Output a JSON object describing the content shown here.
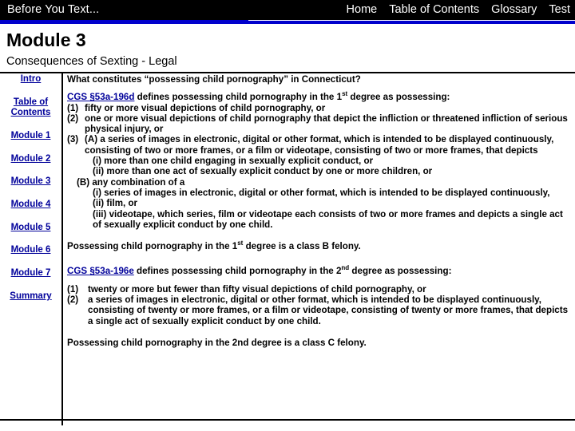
{
  "header": {
    "brand": "Before You Text...",
    "nav": [
      {
        "label": "Home",
        "name": "nav-home"
      },
      {
        "label": "Table of Contents",
        "name": "nav-table-of-contents"
      },
      {
        "label": "Glossary",
        "name": "nav-glossary"
      },
      {
        "label": "Test",
        "name": "nav-test"
      }
    ],
    "accent_color": "#0000CC",
    "bar_color": "#000000"
  },
  "page": {
    "title": "Module 3",
    "subtitle": "Consequences of Sexting - Legal"
  },
  "sidebar": {
    "link_color": "#00009A",
    "items": [
      {
        "label": "Intro"
      },
      {
        "label": "Table of Contents"
      },
      {
        "label": "Module 1"
      },
      {
        "label": "Module 2"
      },
      {
        "label": "Module 3"
      },
      {
        "label": "Module 4"
      },
      {
        "label": "Module 5"
      },
      {
        "label": "Module 6"
      },
      {
        "label": "Module 7"
      },
      {
        "label": "Summary"
      }
    ]
  },
  "content": {
    "heading": "What constitutes “possessing child pornography” in Connecticut?",
    "stat1": {
      "link": "CGS §53a-196d",
      "lead_before": " defines possessing child pornography in the 1",
      "lead_sup": "st",
      "lead_after": " degree as possessing:",
      "item1_marker": "(1)",
      "item1_text": "fifty or more visual depictions of child pornography, or",
      "item2_marker": "(2)",
      "item2_text": "one or more visual depictions of child pornography that depict the infliction or threatened infliction of serious physical injury, or",
      "item3_marker": "(3)",
      "item3_a": "(A) a series of images in electronic, digital or other format, which is intended to be displayed continuously, consisting of two or more frames, or a film or videotape, consisting of two or more frames, that depicts",
      "item3_a_i": "(i) more than one child engaging in sexually explicit conduct, or",
      "item3_a_ii": "(ii) more than one act of sexually explicit conduct by one or more children, or",
      "item3_b": "(B) any combination of a",
      "item3_b_i": "(i) series of images in electronic, digital or other format, which is intended to be displayed continuously,",
      "item3_b_ii": "(ii) film, or",
      "item3_b_iii": "(iii) videotape, which series, film or videotape each consists of two or more frames and depicts a single act of sexually explicit conduct by one child."
    },
    "penalty1_before": "Possessing child pornography in the 1",
    "penalty1_sup": "st",
    "penalty1_after": " degree is a class B felony.",
    "stat2": {
      "link": "CGS §53a-196e",
      "lead_before": " defines possessing child pornography in the 2",
      "lead_sup": "nd",
      "lead_after": "  degree as possessing:",
      "item1_marker": "(1)",
      "item1_text": "twenty or more but fewer than fifty visual depictions of child pornography, or",
      "item2_marker": "(2)",
      "item2_text": "a series of images in electronic, digital or other format, which is intended to be displayed continuously, consisting of twenty or more frames, or a film or videotape, consisting of twenty or more frames, that depicts a single act of sexually explicit conduct by one child."
    },
    "penalty2": "Possessing child pornography in the 2nd degree is a class C felony."
  }
}
